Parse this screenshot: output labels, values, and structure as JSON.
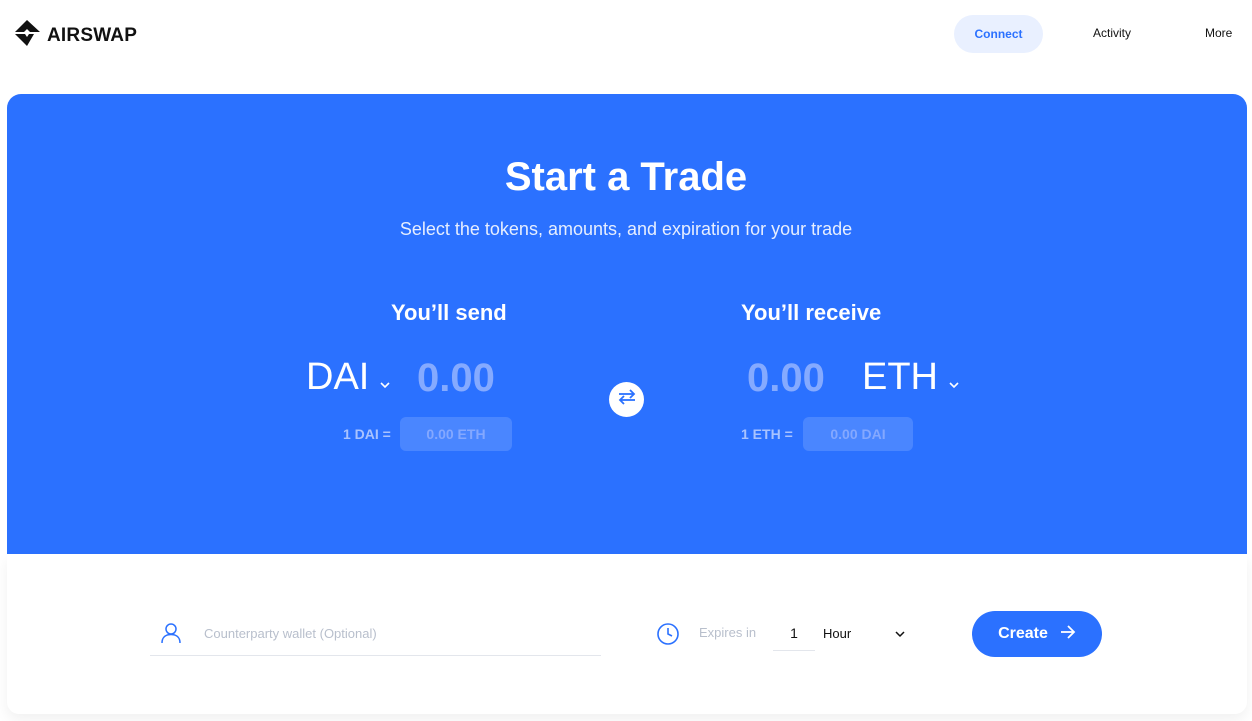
{
  "header": {
    "brand": "AIRSWAP",
    "nav": {
      "connect": "Connect",
      "activity": "Activity",
      "more": "More"
    }
  },
  "hero": {
    "title": "Start a Trade",
    "subtitle": "Select the tokens, amounts, and expiration for your trade"
  },
  "send": {
    "label": "You’ll send",
    "token": "DAI",
    "amount": "0.00",
    "rate_label": "1 DAI =",
    "rate_value": "0.00 ETH"
  },
  "receive": {
    "label": "You’ll receive",
    "token": "ETH",
    "amount": "0.00",
    "rate_label": "1 ETH =",
    "rate_value": "0.00 DAI"
  },
  "form": {
    "wallet_placeholder": "Counterparty wallet (Optional)",
    "expires_label": "Expires in",
    "expires_value": "1",
    "expires_unit": "Hour",
    "create_label": "Create"
  },
  "colors": {
    "accent": "#2b71ff",
    "connect_bg": "#e9f0ff"
  },
  "icons": {
    "logo": "airswap-logo-icon",
    "swap": "swap-arrows-icon",
    "user": "user-icon",
    "clock": "clock-icon",
    "chevron": "chevron-down-icon",
    "arrow": "arrow-right-icon"
  }
}
